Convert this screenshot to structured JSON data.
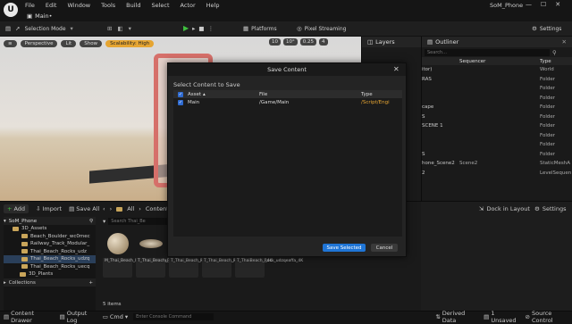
{
  "app": {
    "project_name": "SoM_Phone",
    "level_tab": "Main•"
  },
  "menu": [
    "File",
    "Edit",
    "Window",
    "Tools",
    "Build",
    "Select",
    "Actor",
    "Help"
  ],
  "toolbar": {
    "selection_mode": "Selection Mode",
    "platforms": "Platforms",
    "pixel_streaming": "Pixel Streaming",
    "settings": "Settings"
  },
  "viewport": {
    "perspective": "Perspective",
    "lit": "Lit",
    "show": "Show",
    "scalability": "Scalability: High",
    "grid": "10",
    "rot": "10°",
    "scale": "0.25",
    "cams": "4"
  },
  "layers": {
    "tab": "Layers"
  },
  "outliner": {
    "tab": "Outliner",
    "search_placeholder": "Search...",
    "col_sequencer": "Sequencer",
    "col_type": "Type",
    "rows": [
      {
        "label": "itor)",
        "seq": "",
        "type": "World"
      },
      {
        "label": "RAS",
        "seq": "",
        "type": "Folder"
      },
      {
        "label": "",
        "seq": "",
        "type": "Folder"
      },
      {
        "label": "",
        "seq": "",
        "type": "Folder"
      },
      {
        "label": "cape",
        "seq": "",
        "type": "Folder"
      },
      {
        "label": "S",
        "seq": "",
        "type": "Folder"
      },
      {
        "label": "SCENE 1",
        "seq": "",
        "type": "Folder"
      },
      {
        "label": "",
        "seq": "",
        "type": "Folder"
      },
      {
        "label": "",
        "seq": "",
        "type": "Folder"
      },
      {
        "label": "S",
        "seq": "",
        "type": "Folder"
      },
      {
        "label": "hone_Scene2",
        "seq": "Scene2",
        "type": "StaticMeshA"
      },
      {
        "label": "2",
        "seq": "",
        "type": "LevelSequen"
      }
    ]
  },
  "details": {
    "dock": "Dock in Layout",
    "settings": "Settings"
  },
  "content_browser": {
    "add": "Add",
    "import": "Import",
    "save_all": "Save All",
    "breadcrumb_all": "All",
    "breadcrumb_content": "Content",
    "search_placeholder": "Search Thai_Be",
    "project_root": "SoM_Phone",
    "tree": [
      {
        "label": "3D_Assets",
        "selected": false
      },
      {
        "label": "Beach_Boulder_wc0mec",
        "selected": false
      },
      {
        "label": "Railway_Track_Modular_",
        "selected": false
      },
      {
        "label": "Thai_Beach_Rocks_udz",
        "selected": false
      },
      {
        "label": "Thai_Beach_Rocks_udzq",
        "selected": true
      },
      {
        "label": "Thai_Beach_Rocks_uecq",
        "selected": false
      },
      {
        "label": "3D_Plants",
        "selected": false
      },
      {
        "label": "Surfaces",
        "selected": false
      }
    ],
    "collections": "Collections",
    "item_count": "5 items",
    "assets": [
      {
        "label": "M_Thai_Beach_Rock_udzqeaffa_M",
        "icon": "sphere-icon"
      },
      {
        "label": "T_Thai_Beach_Rock_udzqeaffa_4K",
        "icon": "disc-icon"
      },
      {
        "label": "T_Thai_Beach_Rock_udzqeaffa_4K",
        "icon": "blank-icon"
      },
      {
        "label": "T_Thai_Beach_Rock_udzqeaffa_4K",
        "icon": "blank-icon"
      },
      {
        "label": "T_ThaiBeach_Rock_udzqeaffa_4K",
        "icon": "blank-icon"
      }
    ]
  },
  "status": {
    "content_drawer": "Content Drawer",
    "output_log": "Output Log",
    "cmd": "Cmd",
    "console_placeholder": "Enter Console Command",
    "derived_data": "Derived Data",
    "unsaved": "1 Unsaved",
    "source_control": "Source Control"
  },
  "dialog": {
    "title": "Save Content",
    "subtitle": "Select Content to Save",
    "col_asset": "Asset",
    "col_file": "File",
    "col_type": "Type",
    "row": {
      "asset": "Main",
      "file": "/Game/Main",
      "type": "/Script/Engi"
    },
    "save_button": "Save Selected",
    "cancel_button": "Cancel"
  },
  "colors": {
    "accent": "#1f75d6",
    "scalability": "#e6a532",
    "type_orange": "#e6a532"
  }
}
